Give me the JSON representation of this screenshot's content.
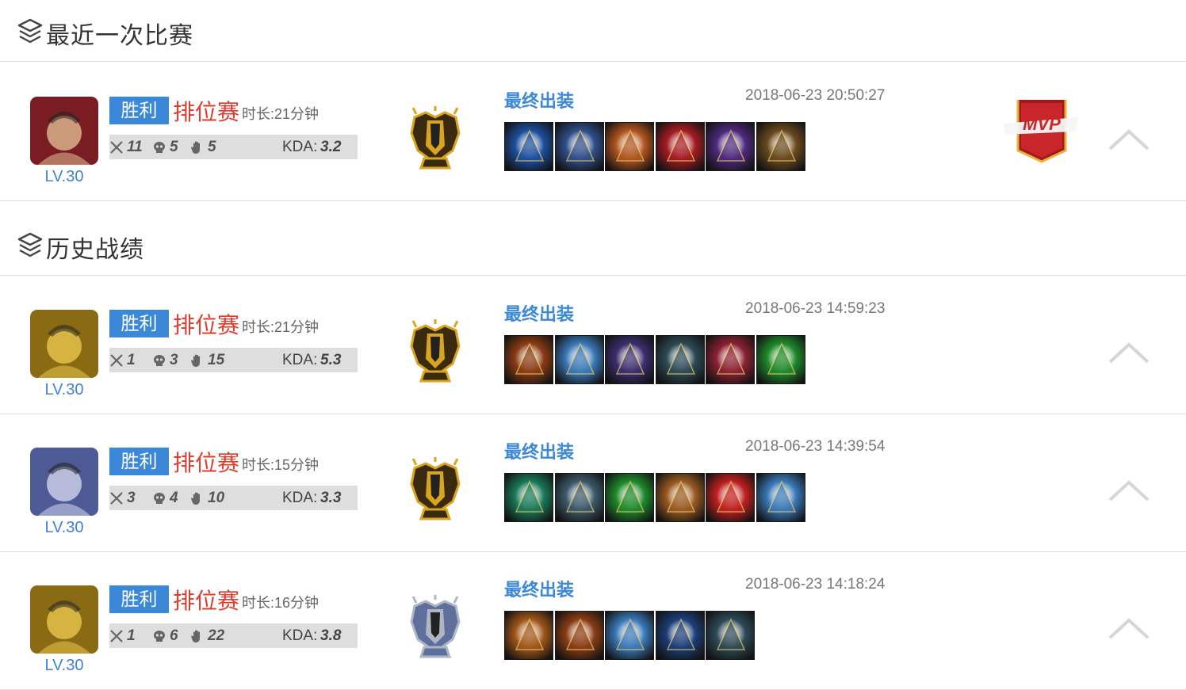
{
  "sections": {
    "latest": {
      "title": "最近一次比赛"
    },
    "history": {
      "title": "历史战绩"
    }
  },
  "matches": [
    {
      "level": "LV.30",
      "result": "胜利",
      "mode": "排位赛",
      "duration": "时长:21分钟",
      "kills": "11",
      "deaths": "5",
      "assists": "5",
      "kda_label": "KDA:",
      "kda": "3.2",
      "build_title": "最终出装",
      "time": "2018-06-23 20:50:27",
      "mvp": "MVP",
      "rank_icon": "gold-shield-badge-icon",
      "hero_colors": [
        "#7a1d22",
        "#d9b08a"
      ],
      "item_colors": [
        "#1d4f9e",
        "#2f4f8a",
        "#b0551f",
        "#a51c23",
        "#4e2a7d",
        "#6b4a1f"
      ]
    },
    {
      "level": "LV.30",
      "result": "胜利",
      "mode": "排位赛",
      "duration": "时长:21分钟",
      "kills": "1",
      "deaths": "3",
      "assists": "15",
      "kda_label": "KDA:",
      "kda": "5.3",
      "build_title": "最终出装",
      "time": "2018-06-23 14:59:23",
      "rank_icon": "gold-shield-badge-icon",
      "hero_colors": [
        "#8a6a12",
        "#e4c04a"
      ],
      "item_colors": [
        "#8a3c14",
        "#3a79b8",
        "#3b2f6e",
        "#2d4a56",
        "#8b2232",
        "#1f8a2c"
      ]
    },
    {
      "level": "LV.30",
      "result": "胜利",
      "mode": "排位赛",
      "duration": "时长:15分钟",
      "kills": "3",
      "deaths": "4",
      "assists": "10",
      "kda_label": "KDA:",
      "kda": "3.3",
      "build_title": "最终出装",
      "time": "2018-06-23 14:39:54",
      "rank_icon": "gold-shield-badge-icon",
      "hero_colors": [
        "#4d5a96",
        "#c9cde6"
      ],
      "item_colors": [
        "#1a7a5a",
        "#3c5a6a",
        "#1f8a2c",
        "#9a5a22",
        "#c02020",
        "#3a79b8"
      ]
    },
    {
      "level": "LV.30",
      "result": "胜利",
      "mode": "排位赛",
      "duration": "时长:16分钟",
      "kills": "1",
      "deaths": "6",
      "assists": "22",
      "kda_label": "KDA:",
      "kda": "3.8",
      "build_title": "最终出装",
      "time": "2018-06-23 14:18:24",
      "rank_icon": "silver-shield-badge-icon",
      "hero_colors": [
        "#8a6a12",
        "#e4c04a"
      ],
      "item_colors": [
        "#a0561a",
        "#8a3c14",
        "#3a79b8",
        "#1c3f7a",
        "#2d4a56"
      ]
    }
  ],
  "colors": {
    "accent": "#3b88d9",
    "mode_red": "#e13a2a",
    "level_blue": "#3f83cf",
    "stats_bg": "#dedede"
  }
}
